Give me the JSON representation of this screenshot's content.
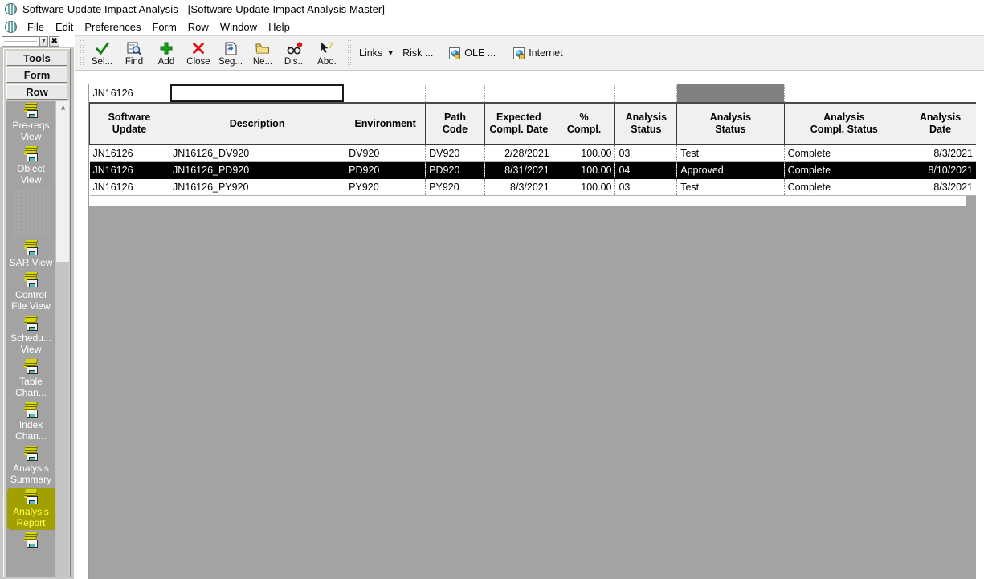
{
  "window": {
    "title": "Software Update Impact Analysis - [Software Update Impact Analysis Master]",
    "app_icon": "app-globe-icon"
  },
  "menubar": {
    "items": [
      {
        "label": "File"
      },
      {
        "label": "Edit"
      },
      {
        "label": "Preferences"
      },
      {
        "label": "Form"
      },
      {
        "label": "Row"
      },
      {
        "label": "Window"
      },
      {
        "label": "Help"
      }
    ]
  },
  "mdi_controls": {
    "restore_arrow": "▼",
    "close_label": "✖"
  },
  "toolbar": {
    "buttons": [
      {
        "label": "Sel...",
        "icon": "check-icon",
        "accel": "S"
      },
      {
        "label": "Find",
        "icon": "find-magnifier-icon",
        "accel": "i"
      },
      {
        "label": "Add",
        "icon": "plus-icon",
        "accel": "A"
      },
      {
        "label": "Close",
        "icon": "close-x-icon",
        "accel": "C"
      },
      {
        "label": "Seg...",
        "icon": "document-arrow-icon",
        "accel": "S"
      },
      {
        "label": "Ne...",
        "icon": "folder-open-icon",
        "accel": "Ne"
      },
      {
        "label": "Dis...",
        "icon": "glasses-icon",
        "accel": "D"
      },
      {
        "label": "Abo.",
        "icon": "cursor-help-icon",
        "accel": "b"
      }
    ],
    "links": {
      "label": "Links",
      "caret": "▼",
      "risk_label": "Risk ..."
    },
    "ole_label": "OLE ...",
    "internet_label": "Internet"
  },
  "sidebar": {
    "tabs": [
      {
        "label": "Tools"
      },
      {
        "label": "Form"
      },
      {
        "label": "Row"
      }
    ],
    "items": [
      {
        "label": "Pre-reqs View",
        "icon": "report-drawer-icon",
        "selected": false,
        "ghost": false
      },
      {
        "label": "Object View",
        "icon": "report-drawer-icon",
        "selected": false,
        "ghost": false
      },
      {
        "label": "",
        "icon": "partial-render-icon",
        "selected": false,
        "ghost": true
      },
      {
        "label": "SAR View",
        "icon": "report-drawer-icon",
        "selected": false,
        "ghost": false
      },
      {
        "label": "Control File View",
        "icon": "report-drawer-icon",
        "selected": false,
        "ghost": false
      },
      {
        "label": "Schedu... View",
        "icon": "report-drawer-icon",
        "selected": false,
        "ghost": false
      },
      {
        "label": "Table Chan...",
        "icon": "report-drawer-icon",
        "selected": false,
        "ghost": false
      },
      {
        "label": "Index Chan...",
        "icon": "report-drawer-icon",
        "selected": false,
        "ghost": false
      },
      {
        "label": "Analysis Summary",
        "icon": "report-drawer-icon",
        "selected": false,
        "ghost": false
      },
      {
        "label": "Analysis Report",
        "icon": "report-drawer-icon",
        "selected": true,
        "ghost": false
      }
    ],
    "scrollbar": {
      "up_arrow": "∧"
    },
    "selected_color": "#a0a000",
    "selected_text_color": "#ffff4d"
  },
  "grid": {
    "columns": [
      {
        "key": "software_update",
        "header_line1": "Software",
        "header_line2": "Update",
        "align": "left"
      },
      {
        "key": "description",
        "header_line1": "Description",
        "header_line2": "",
        "align": "left"
      },
      {
        "key": "environment",
        "header_line1": "Environment",
        "header_line2": "",
        "align": "left"
      },
      {
        "key": "path_code",
        "header_line1": "Path",
        "header_line2": "Code",
        "align": "left"
      },
      {
        "key": "expected_compl_date",
        "header_line1": "Expected",
        "header_line2": "Compl. Date",
        "align": "right"
      },
      {
        "key": "pct_compl",
        "header_line1": "%",
        "header_line2": "Compl.",
        "align": "right"
      },
      {
        "key": "analysis_status_code",
        "header_line1": "Analysis",
        "header_line2": "Status",
        "align": "left"
      },
      {
        "key": "analysis_status_desc",
        "header_line1": "Analysis",
        "header_line2": "Status",
        "align": "left"
      },
      {
        "key": "analysis_compl_status",
        "header_line1": "Analysis",
        "header_line2": "Compl. Status",
        "align": "left"
      },
      {
        "key": "analysis_date",
        "header_line1": "Analysis",
        "header_line2": "Date",
        "align": "right"
      }
    ],
    "filter_row": {
      "software_update": "JN16126",
      "description": "",
      "environment": "",
      "path_code": "",
      "expected_compl_date": "",
      "pct_compl": "",
      "analysis_status_code": "",
      "analysis_status_desc": "",
      "analysis_compl_status": "",
      "analysis_date": "",
      "active_cell": "description",
      "selected_cell": "analysis_status_desc",
      "selected_cell_color": "#808080"
    },
    "rows": [
      {
        "software_update": "JN16126",
        "description": "JN16126_DV920",
        "environment": "DV920",
        "path_code": "DV920",
        "expected_compl_date": "2/28/2021",
        "pct_compl": "100.00",
        "analysis_status_code": "03",
        "analysis_status_desc": "Test",
        "analysis_compl_status": "Complete",
        "analysis_date": "8/3/2021",
        "selected": false
      },
      {
        "software_update": "JN16126",
        "description": "JN16126_PD920",
        "environment": "PD920",
        "path_code": "PD920",
        "expected_compl_date": "8/31/2021",
        "pct_compl": "100.00",
        "analysis_status_code": "04",
        "analysis_status_desc": "Approved",
        "analysis_compl_status": "Complete",
        "analysis_date": "8/10/2021",
        "selected": true
      },
      {
        "software_update": "JN16126",
        "description": "JN16126_PY920",
        "environment": "PY920",
        "path_code": "PY920",
        "expected_compl_date": "8/3/2021",
        "pct_compl": "100.00",
        "analysis_status_code": "03",
        "analysis_status_desc": "Test",
        "analysis_compl_status": "Complete",
        "analysis_date": "8/3/2021",
        "selected": false
      }
    ]
  }
}
